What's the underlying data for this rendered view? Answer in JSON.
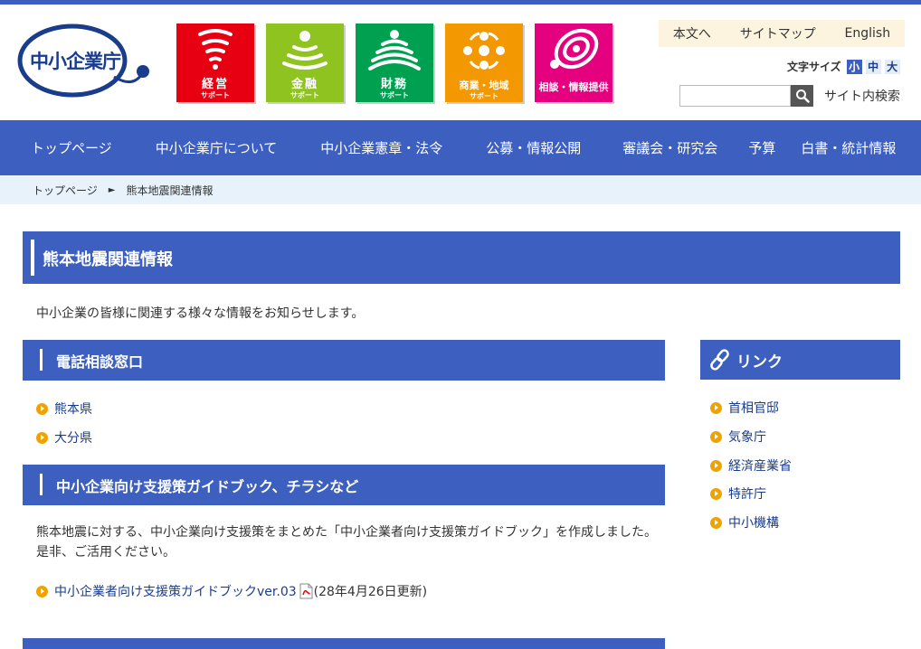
{
  "logo": {
    "text": "中小企業庁"
  },
  "tiles": [
    {
      "t1": "経営",
      "t2": "サポート",
      "color": "#e60012"
    },
    {
      "t1": "金融",
      "t2": "サポート",
      "color": "#8fc31f"
    },
    {
      "t1": "財務",
      "t2": "サポート",
      "color": "#00a051"
    },
    {
      "t1": "商業・地域",
      "t2": "サポート",
      "color": "#f39800"
    },
    {
      "t1": "相談・情報提供",
      "t2": "",
      "color": "#e4007f"
    }
  ],
  "util": {
    "skip": "本文へ",
    "sitemap": "サイトマップ",
    "english": "English"
  },
  "fontsize": {
    "label": "文字サイズ",
    "small": "小",
    "medium": "中",
    "large": "大"
  },
  "search": {
    "placeholder": "",
    "label": "サイト内検索"
  },
  "nav": [
    "トップページ",
    "中小企業庁について",
    "中小企業憲章・法令",
    "公募・情報公開",
    "審議会・研究会",
    "予算",
    "白書・統計情報"
  ],
  "breadcrumb": {
    "home": "トップページ",
    "sep": "►",
    "current": "熊本地震関連情報"
  },
  "page": {
    "title": "熊本地震関連情報",
    "intro": "中小企業の皆様に関連する様々な情報をお知らせします。"
  },
  "sections": {
    "phone": {
      "title": "電話相談窓口",
      "items": [
        "熊本県",
        "大分県"
      ]
    },
    "guide": {
      "title": "中小企業向け支援策ガイドブック、チラシなど",
      "body": "熊本地震に対する、中小企業向け支援策をまとめた「中小企業者向け支援策ガイドブック」を作成しました。是非、ご活用ください。",
      "link": "中小企業者向け支援策ガイドブックver.03",
      "note": "(28年4月26日更新)"
    }
  },
  "links": {
    "title": "リンク",
    "items": [
      "首相官邸",
      "気象庁",
      "経済産業省",
      "特許庁",
      "中小機構"
    ]
  },
  "colors": {
    "primary": "#3d5fbf",
    "bullet": "#f0a300",
    "crumb_bg": "#e8f2fa",
    "util_bg": "#fcf4de"
  }
}
